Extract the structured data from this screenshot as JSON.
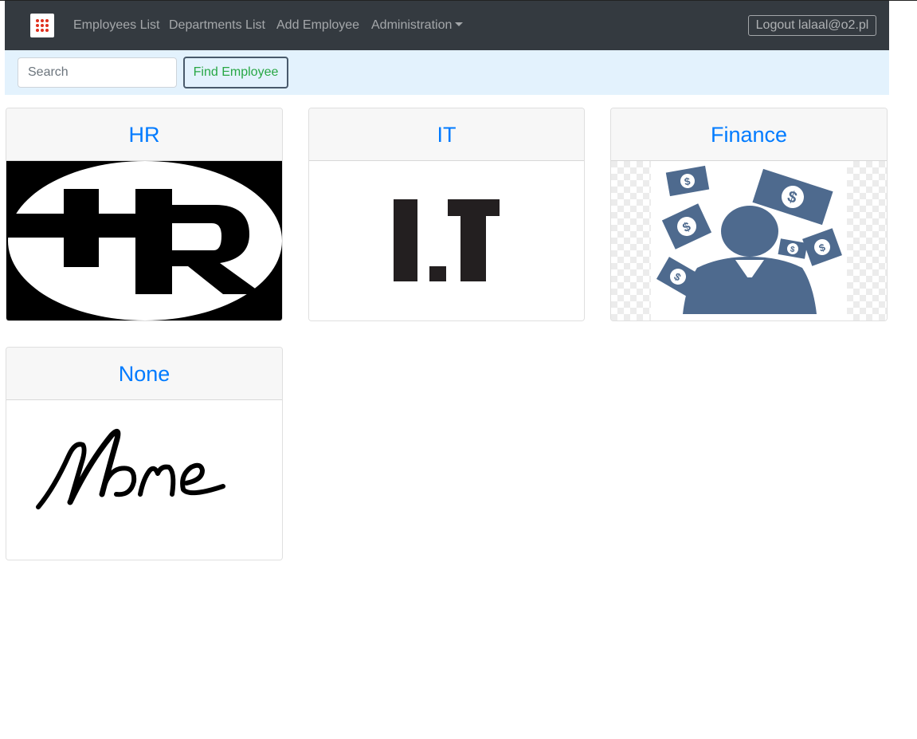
{
  "navbar": {
    "brand_icon": "grid-dots-icon",
    "links": [
      {
        "label": "Employees List"
      },
      {
        "label": "Departments List"
      },
      {
        "label": "Add Employee"
      },
      {
        "label": "Administration",
        "has_dropdown": true
      }
    ],
    "logout_label": "Logout lalaal@o2.pl"
  },
  "search": {
    "placeholder": "Search",
    "value": "",
    "button_label": "Find Employee"
  },
  "departments": [
    {
      "name": "HR",
      "image": "hr-logo-image"
    },
    {
      "name": "IT",
      "image": "it-logo-image"
    },
    {
      "name": "Finance",
      "image": "finance-person-money-image"
    },
    {
      "name": "None",
      "image": "none-script-image"
    }
  ],
  "colors": {
    "navbar_bg": "#343a40",
    "searchbar_bg": "#e3f2fd",
    "title_blue": "#007bff",
    "find_button_text": "#28a745",
    "finance_icon": "#4e6a8e",
    "brand_dots": "#e0301e"
  }
}
